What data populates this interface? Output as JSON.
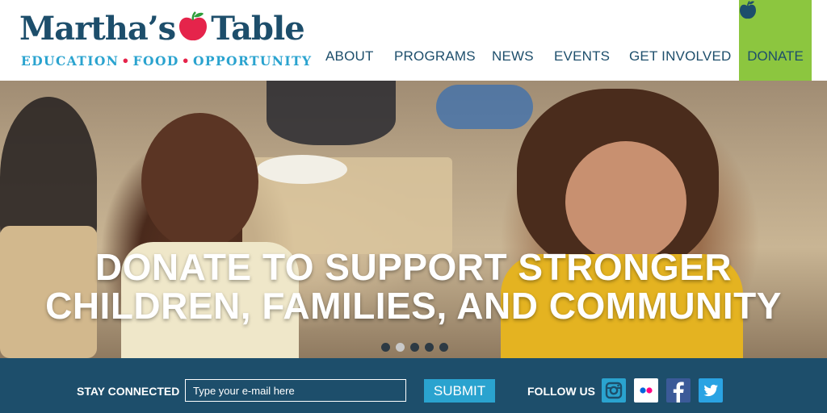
{
  "brand": {
    "name_part1": "Martha’s",
    "name_part2": "Table",
    "tagline_1": "EDUCATION",
    "tagline_2": "FOOD",
    "tagline_3": "OPPORTUNITY",
    "logo_icon": "apple-icon",
    "colors": {
      "navy": "#1d4e6b",
      "red": "#e5244b",
      "green": "#2f9e3c",
      "cyan": "#2aa3cf",
      "lime": "#8cc63f"
    }
  },
  "nav": {
    "items": [
      {
        "label": "ABOUT"
      },
      {
        "label": "PROGRAMS"
      },
      {
        "label": "NEWS"
      },
      {
        "label": "EVENTS"
      },
      {
        "label": "GET INVOLVED"
      }
    ],
    "donate": {
      "label": "DONATE",
      "icon": "apple-icon"
    }
  },
  "hero": {
    "caption_line1": "DONATE TO SUPPORT STRONGER",
    "caption_line2": "CHILDREN, FAMILIES, AND COMMUNITY",
    "slides": 5,
    "active_slide": 2
  },
  "footer": {
    "stay_connected": "STAY CONNECTED",
    "email_placeholder": "Type your e-mail here",
    "submit_label": "SUBMIT",
    "follow_us": "FOLLOW US",
    "social": [
      {
        "icon": "instagram-icon",
        "color": "#1d4e6b"
      },
      {
        "icon": "flickr-icon",
        "color": "#ffffff"
      },
      {
        "icon": "facebook-icon",
        "color": "#3b5a98"
      },
      {
        "icon": "twitter-icon",
        "color": "#2aa3e3"
      }
    ]
  }
}
